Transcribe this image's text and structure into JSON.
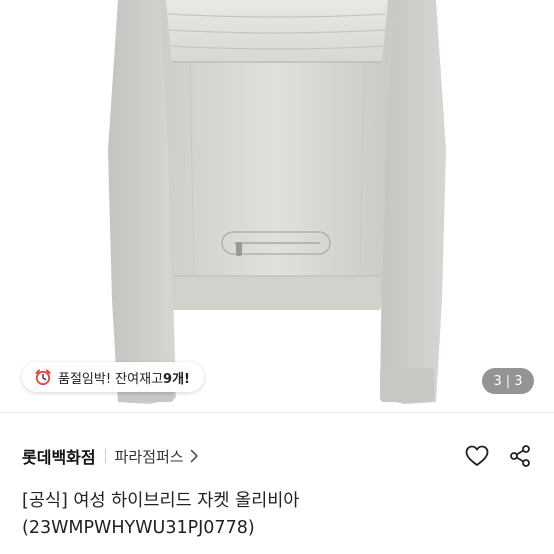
{
  "stock_badge": {
    "icon": "alarm-clock-icon",
    "text": "품절임박! 잔여재고 ",
    "count": "9개!"
  },
  "image_pager": {
    "current": "3",
    "separator": "|",
    "total": "3"
  },
  "seller": {
    "brand": "롯데백화점",
    "store": "파라점퍼스"
  },
  "actions": {
    "like_icon": "heart-icon",
    "share_icon": "share-icon"
  },
  "product": {
    "title_line1": "[공식] 여성 하이브리드 자켓 올리비아",
    "title_line2": "(23WMPWHYWU31PJ0778)"
  },
  "colors": {
    "jacket": "#dedcd8",
    "badge_count": "#111111",
    "pager_bg": "rgba(0,0,0,0.42)"
  }
}
